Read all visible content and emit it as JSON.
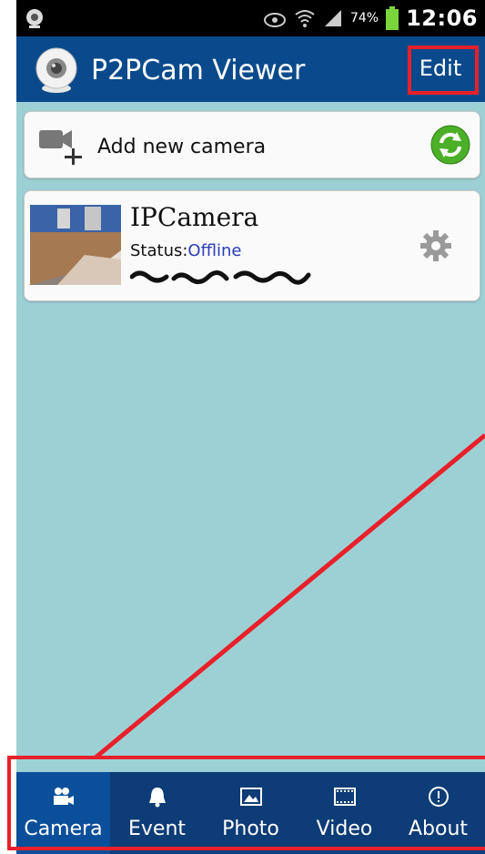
{
  "status_bar": {
    "battery": "74%",
    "time": "12:06"
  },
  "app_bar": {
    "title": "P2PCam Viewer",
    "edit_label": "Edit"
  },
  "add_camera": {
    "label": "Add new camera"
  },
  "camera": {
    "name": "IPCamera",
    "status_label": "Status:",
    "status_value": "Offline",
    "status_color": "#2a3db5"
  },
  "bottom_nav": {
    "tabs": [
      {
        "label": "Camera",
        "icon": "video-camera-icon",
        "active": true
      },
      {
        "label": "Event",
        "icon": "bell-icon",
        "active": false
      },
      {
        "label": "Photo",
        "icon": "photo-icon",
        "active": false
      },
      {
        "label": "Video",
        "icon": "film-icon",
        "active": false
      },
      {
        "label": "About",
        "icon": "info-icon",
        "active": false
      }
    ]
  },
  "colors": {
    "app_bar": "#0a4a8c",
    "background": "#9dd0d5",
    "bottom_nav": "#0d3c76",
    "annotation": "#e8202a"
  }
}
